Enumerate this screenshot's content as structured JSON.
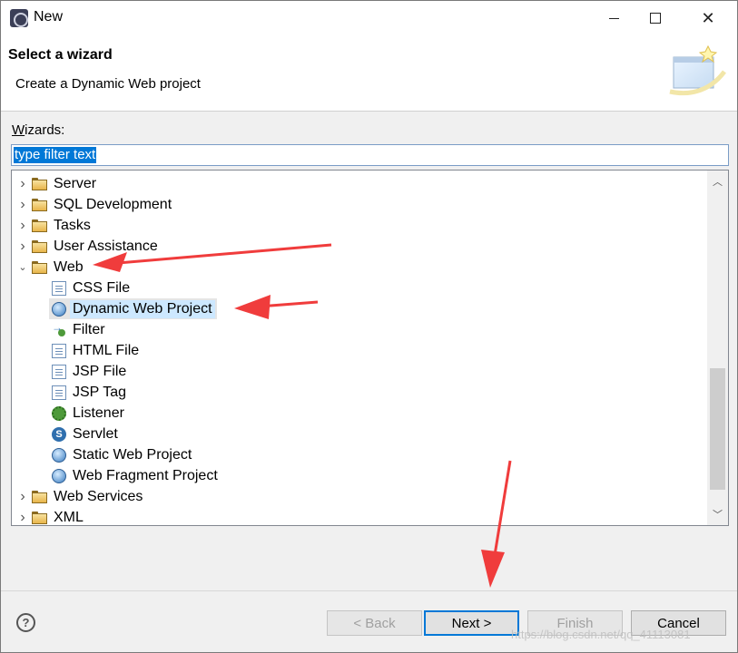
{
  "window": {
    "title": "New"
  },
  "header": {
    "title": "Select a wizard",
    "description": "Create a Dynamic Web project"
  },
  "wizards": {
    "label_prefix": "W",
    "label_rest": "izards:",
    "filter_value": "type filter text"
  },
  "tree": {
    "items": [
      {
        "label": "Server",
        "type": "folder",
        "expanded": false
      },
      {
        "label": "SQL Development",
        "type": "folder",
        "expanded": false
      },
      {
        "label": "Tasks",
        "type": "folder",
        "expanded": false
      },
      {
        "label": "User Assistance",
        "type": "folder",
        "expanded": false
      },
      {
        "label": "Web",
        "type": "folder",
        "expanded": true
      },
      {
        "label": "CSS File",
        "type": "item",
        "icon": "css-file-icon"
      },
      {
        "label": "Dynamic Web Project",
        "type": "item",
        "icon": "dynamic-web-project-icon",
        "selected": true
      },
      {
        "label": "Filter",
        "type": "item",
        "icon": "filter-icon"
      },
      {
        "label": "HTML File",
        "type": "item",
        "icon": "html-file-icon"
      },
      {
        "label": "JSP File",
        "type": "item",
        "icon": "jsp-file-icon"
      },
      {
        "label": "JSP Tag",
        "type": "item",
        "icon": "jsp-tag-icon"
      },
      {
        "label": "Listener",
        "type": "item",
        "icon": "listener-icon"
      },
      {
        "label": "Servlet",
        "type": "item",
        "icon": "servlet-icon"
      },
      {
        "label": "Static Web Project",
        "type": "item",
        "icon": "static-web-project-icon"
      },
      {
        "label": "Web Fragment Project",
        "type": "item",
        "icon": "web-fragment-project-icon"
      },
      {
        "label": "Web Services",
        "type": "folder",
        "expanded": false
      },
      {
        "label": "XML",
        "type": "folder",
        "expanded": false
      }
    ]
  },
  "buttons": {
    "back": "< Back",
    "next": "Next >",
    "finish": "Finish",
    "cancel": "Cancel",
    "help": "?"
  },
  "watermark": "https://blog.csdn.net/qq_41113081",
  "colors": {
    "accent": "#0078d7",
    "annotation_arrow": "#f03c3c",
    "selection": "#e5e5e5"
  }
}
